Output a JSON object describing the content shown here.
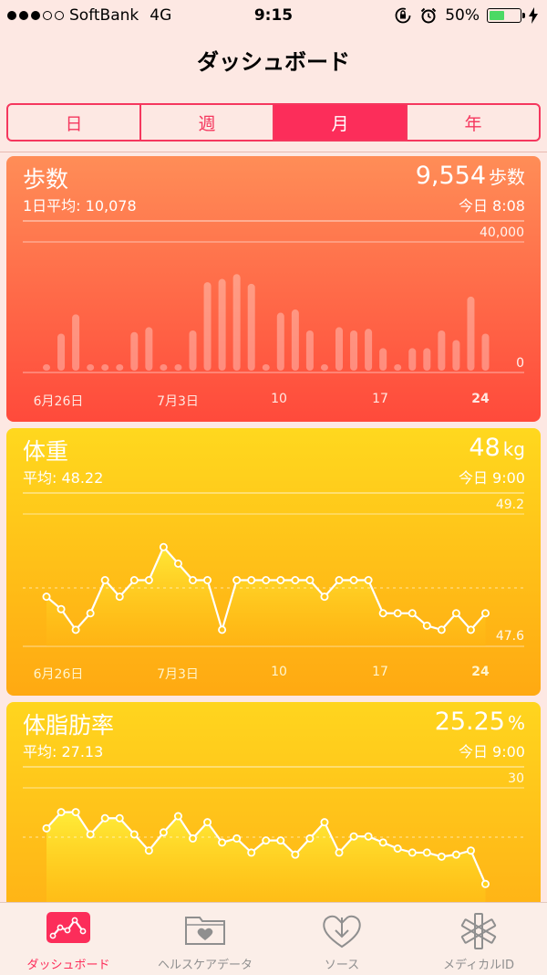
{
  "status_bar": {
    "carrier": "SoftBank",
    "network": "4G",
    "time": "9:15",
    "battery": "50%",
    "signal_bars": [
      true,
      true,
      true,
      false,
      false
    ],
    "battery_level": 0.5
  },
  "nav": {
    "title": "ダッシュボード"
  },
  "segments": [
    {
      "label": "日",
      "active": false
    },
    {
      "label": "週",
      "active": false
    },
    {
      "label": "月",
      "active": true
    },
    {
      "label": "年",
      "active": false
    }
  ],
  "steps_card": {
    "title": "歩数",
    "subtitle": "1日平均: 10,078",
    "value": "9,554",
    "unit": "歩数",
    "time": "今日 8:08",
    "y_max_label": "40,000",
    "y_min_label": "0",
    "x_labels": [
      "6月26日",
      "7月3日",
      "10",
      "17",
      "24"
    ],
    "color": "#ff5a3e"
  },
  "weight_card": {
    "title": "体重",
    "subtitle": "平均: 48.22",
    "value": "48",
    "unit": "kg",
    "time": "今日 9:00",
    "y_max_label": "49.2",
    "y_min_label": "47.6",
    "x_labels": [
      "6月26日",
      "7月3日",
      "10",
      "17",
      "24"
    ],
    "color": "#ffb812"
  },
  "fat_card": {
    "title": "体脂肪率",
    "subtitle": "平均: 27.13",
    "value": "25.25",
    "unit": "%",
    "time": "今日 9:00",
    "y_max_label": "30",
    "color": "#ffc01a"
  },
  "tabs": [
    {
      "label": "ダッシュボード",
      "icon": "dashboard-chart-icon",
      "active": true
    },
    {
      "label": "ヘルスケアデータ",
      "icon": "health-data-folder-heart-icon",
      "active": false
    },
    {
      "label": "ソース",
      "icon": "sources-heart-download-icon",
      "active": false
    },
    {
      "label": "メディカルID",
      "icon": "medical-id-asterisk-icon",
      "active": false
    }
  ],
  "accent_color": "#fc2d5a",
  "chart_data": [
    {
      "type": "bar",
      "title": "歩数",
      "x": [
        "6/23",
        "6/24",
        "6/25",
        "6/26",
        "6/27",
        "6/28",
        "6/29",
        "6/30",
        "7/1",
        "7/2",
        "7/3",
        "7/4",
        "7/5",
        "7/6",
        "7/7",
        "7/8",
        "7/9",
        "7/10",
        "7/11",
        "7/12",
        "7/13",
        "7/14",
        "7/15",
        "7/16",
        "7/17",
        "7/18",
        "7/19",
        "7/20",
        "7/21",
        "7/22",
        "7/23",
        "7/24"
      ],
      "values": [
        1500,
        11500,
        17500,
        1500,
        2000,
        1500,
        12000,
        13500,
        1500,
        1500,
        12500,
        27500,
        28500,
        30000,
        27000,
        1500,
        18000,
        19000,
        12500,
        1500,
        13500,
        12500,
        13000,
        7000,
        1500,
        7000,
        7000,
        12500,
        9500,
        23000,
        11500
      ],
      "ylim": [
        0,
        40000
      ]
    },
    {
      "type": "line",
      "title": "体重",
      "x": [
        "6/23",
        "6/24",
        "6/25",
        "6/26",
        "6/27",
        "6/28",
        "6/29",
        "6/30",
        "7/1",
        "7/2",
        "7/3",
        "7/4",
        "7/5",
        "7/6",
        "7/7",
        "7/8",
        "7/9",
        "7/10",
        "7/11",
        "7/12",
        "7/13",
        "7/14",
        "7/15",
        "7/16",
        "7/17",
        "7/18",
        "7/19",
        "7/20",
        "7/21",
        "7/22",
        "7/23",
        "7/24"
      ],
      "values": [
        48.2,
        48.05,
        47.8,
        48.0,
        48.4,
        48.2,
        48.4,
        48.4,
        48.8,
        48.6,
        48.4,
        48.4,
        47.8,
        48.4,
        48.4,
        48.4,
        48.4,
        48.4,
        48.4,
        48.2,
        48.4,
        48.4,
        48.4,
        48.0,
        48.0,
        48.0,
        47.85,
        47.8,
        48.0,
        47.8,
        48.0
      ],
      "ylim": [
        47.6,
        49.2
      ]
    },
    {
      "type": "line",
      "title": "体脂肪率",
      "x": [
        "6/23",
        "6/24",
        "6/25",
        "6/26",
        "6/27",
        "6/28",
        "6/29",
        "6/30",
        "7/1",
        "7/2",
        "7/3",
        "7/4",
        "7/5",
        "7/6",
        "7/7",
        "7/8",
        "7/9",
        "7/10",
        "7/11",
        "7/12",
        "7/13",
        "7/14",
        "7/15",
        "7/16",
        "7/17",
        "7/18",
        "7/19",
        "7/20",
        "7/21",
        "7/22",
        "7/23",
        "7/24",
        "7/25"
      ],
      "values": [
        28.0,
        28.8,
        28.8,
        27.7,
        28.5,
        28.5,
        27.7,
        26.9,
        27.8,
        28.6,
        27.5,
        28.3,
        27.3,
        27.5,
        26.8,
        27.4,
        27.4,
        26.7,
        27.5,
        28.3,
        26.8,
        27.6,
        27.6,
        27.3,
        27.0,
        26.8,
        26.8,
        26.6,
        26.7,
        26.9,
        25.25
      ],
      "ylim": [
        24,
        30
      ]
    }
  ]
}
